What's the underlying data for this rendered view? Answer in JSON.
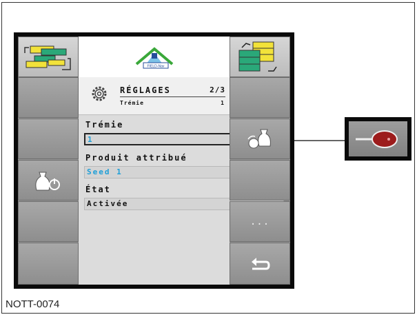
{
  "doc_code": "NOTT-0074",
  "header": {
    "logo_text": "FIELD-Nav",
    "logo_icon": "field-nav-logo"
  },
  "menu": {
    "title": "RÉGLAGES",
    "page": "2/3",
    "subtitle": "Trémie",
    "subtitle_index": "1"
  },
  "fields": [
    {
      "label": "Trémie",
      "value": "1",
      "selected": true,
      "value_color": "#1d9fd8"
    },
    {
      "label": "Produit attribué",
      "value": "Seed 1",
      "selected": false,
      "value_color": "#1d9fd8"
    },
    {
      "label": "État",
      "value": "Activée",
      "selected": false,
      "value_color": "#111111"
    }
  ],
  "softkeys_left": [
    "layout-switch-icon",
    "",
    "",
    "bag-power-icon",
    "",
    ""
  ],
  "softkeys_right": [
    "screen-switch-icon",
    "",
    "bag-swap-icon",
    "",
    "more-icon",
    "back-icon"
  ],
  "more_label": "...",
  "colors": {
    "highlight_value": "#1d9fd8",
    "button_gray": "#9a9a9a",
    "content_bg": "#dcdcdc",
    "icon_green": "#2aa879",
    "icon_yellow": "#f2e23a"
  }
}
